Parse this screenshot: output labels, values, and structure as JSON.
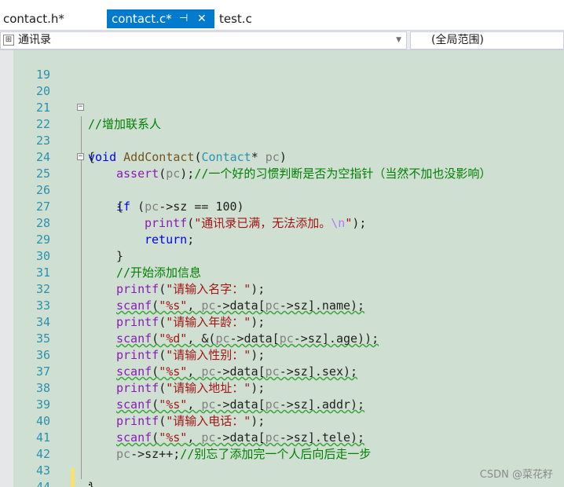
{
  "tabs": {
    "tab1": "contact.h*",
    "tab2": "contact.c*",
    "tab2_pin": "⊣",
    "tab2_close": "✕",
    "tab3": "test.c"
  },
  "navbar": {
    "scope_icon": "⊞",
    "scope_label": "通讯录",
    "scope_arrow": "▼",
    "member_label": "(全局范围)"
  },
  "lines": [
    {
      "n": "19"
    },
    {
      "n": "20"
    },
    {
      "n": "21",
      "comment": "//增加联系人"
    },
    {
      "n": "22",
      "kw": "void",
      "fn": "AddContact",
      "open": "(",
      "type": "Contact",
      "star": "*",
      "param": "pc",
      "close": ")"
    },
    {
      "n": "23",
      "text": "{"
    },
    {
      "n": "24",
      "fn": "assert",
      "open": "(",
      "param": "pc",
      "close": ");",
      "comment": "//一个好的习惯判断是否为空指针（当然不加也没影响）"
    },
    {
      "n": "25",
      "kw": "if",
      "a": " (",
      "param": "pc",
      "b": "->sz == 100)"
    },
    {
      "n": "26",
      "text": "{"
    },
    {
      "n": "27",
      "fn": "printf",
      "open": "(",
      "str": "\"通讯录已满，无法添加。",
      "esc": "\\n",
      "strend": "\"",
      "close": ");"
    },
    {
      "n": "28",
      "kw": "return",
      "close": ";"
    },
    {
      "n": "29",
      "text": "}"
    },
    {
      "n": "30",
      "comment": "//开始添加信息"
    },
    {
      "n": "31",
      "fn": "printf",
      "open": "(",
      "str": "\"请输入名字：\"",
      "close": ");"
    },
    {
      "n": "32",
      "fn": "scanf",
      "open": "(",
      "str": "\"%s\"",
      "c1": ", ",
      "p1": "pc",
      "m1": "->data[",
      "p2": "pc",
      "m2": "->sz].name);"
    },
    {
      "n": "33",
      "fn": "printf",
      "open": "(",
      "str": "\"请输入年龄：\"",
      "close": ");"
    },
    {
      "n": "34",
      "fn": "scanf",
      "open": "(",
      "str": "\"%d\"",
      "c1": ", &(",
      "p1": "pc",
      "m1": "->data[",
      "p2": "pc",
      "m2": "->sz].age));"
    },
    {
      "n": "35",
      "fn": "printf",
      "open": "(",
      "str": "\"请输入性别：\"",
      "close": ");"
    },
    {
      "n": "36",
      "fn": "scanf",
      "open": "(",
      "str": "\"%s\"",
      "c1": ", ",
      "p1": "pc",
      "m1": "->data[",
      "p2": "pc",
      "m2": "->sz].sex);"
    },
    {
      "n": "37",
      "fn": "printf",
      "open": "(",
      "str": "\"请输入地址：\"",
      "close": ");"
    },
    {
      "n": "38",
      "fn": "scanf",
      "open": "(",
      "str": "\"%s\"",
      "c1": ", ",
      "p1": "pc",
      "m1": "->data[",
      "p2": "pc",
      "m2": "->sz].addr);"
    },
    {
      "n": "39",
      "fn": "printf",
      "open": "(",
      "str": "\"请输入电话：\"",
      "close": ");"
    },
    {
      "n": "40",
      "fn": "scanf",
      "open": "(",
      "str": "\"%s\"",
      "c1": ", ",
      "p1": "pc",
      "m1": "->data[",
      "p2": "pc",
      "m2": "->sz].tele);"
    },
    {
      "n": "41",
      "param": "pc",
      "b": "->sz++;",
      "comment": "//别忘了添加完一个人后向后走一步"
    },
    {
      "n": "42"
    },
    {
      "n": "43",
      "text": "}"
    },
    {
      "n": "44"
    }
  ],
  "fold_symbol": "−",
  "watermark": "CSDN @菜花籽",
  "colors": {
    "tab_active_bg": "#007acc",
    "editor_bg": "#cfe0d2",
    "keyword": "#0000ff",
    "type": "#2b91af",
    "string": "#a31515",
    "comment": "#008000",
    "line_number": "#2b91af"
  }
}
